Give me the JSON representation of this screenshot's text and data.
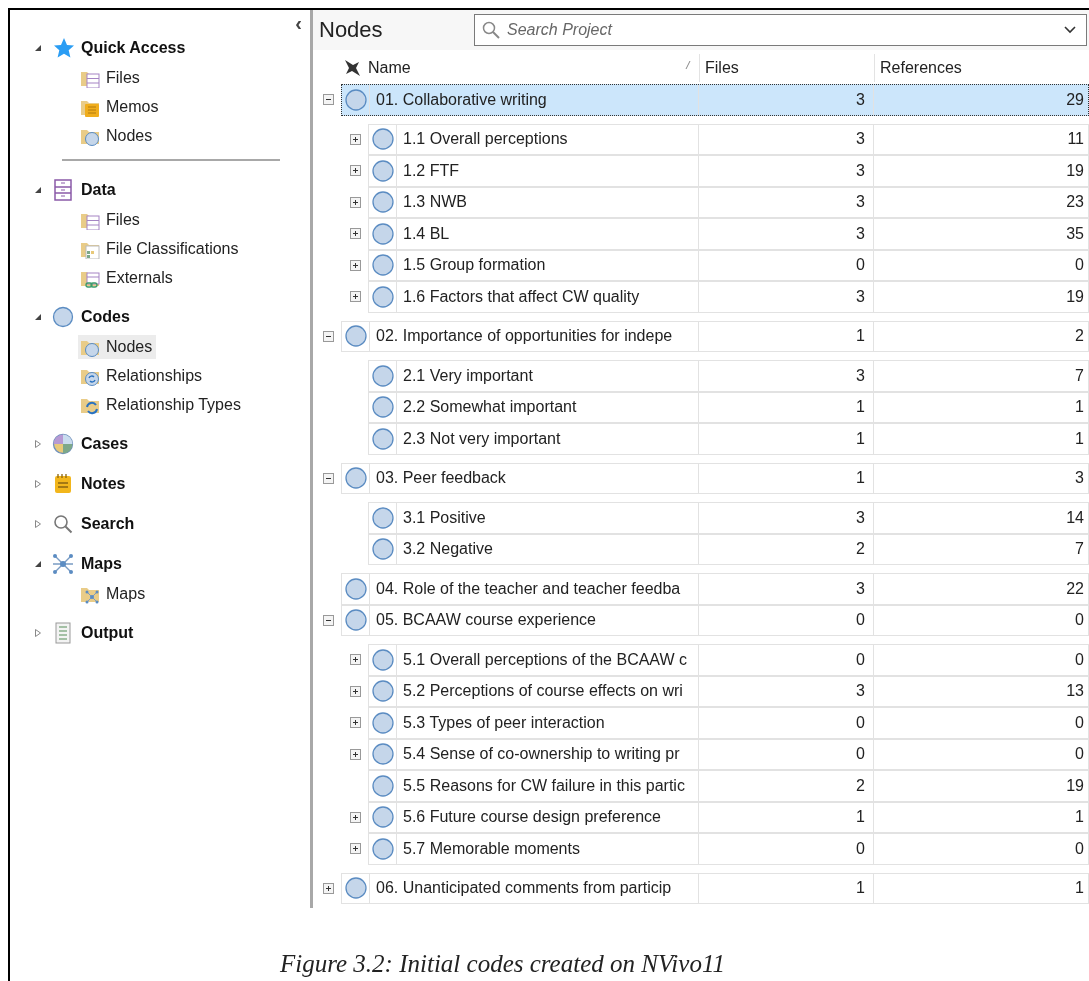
{
  "sidebar": {
    "collapse_glyph": "‹",
    "sections": [
      {
        "label": "Quick Access",
        "kind": "star",
        "expanded": true,
        "divider": true,
        "items": [
          {
            "label": "Files",
            "kind": "files",
            "selected": false
          },
          {
            "label": "Memos",
            "kind": "memos",
            "selected": false
          },
          {
            "label": "Nodes",
            "kind": "nodes",
            "selected": false
          }
        ]
      },
      {
        "label": "Data",
        "kind": "cabinet",
        "expanded": true,
        "divider": false,
        "items": [
          {
            "label": "Files",
            "kind": "files",
            "selected": false
          },
          {
            "label": "File Classifications",
            "kind": "classifications",
            "selected": false
          },
          {
            "label": "Externals",
            "kind": "externals",
            "selected": false
          }
        ]
      },
      {
        "label": "Codes",
        "kind": "node",
        "expanded": true,
        "divider": false,
        "items": [
          {
            "label": "Nodes",
            "kind": "nodes",
            "selected": true
          },
          {
            "label": "Relationships",
            "kind": "relationships",
            "selected": false
          },
          {
            "label": "Relationship Types",
            "kind": "relationship-types",
            "selected": false
          }
        ]
      },
      {
        "label": "Cases",
        "kind": "cases",
        "expanded": false,
        "divider": false
      },
      {
        "label": "Notes",
        "kind": "notes",
        "expanded": false,
        "divider": false
      },
      {
        "label": "Search",
        "kind": "search",
        "expanded": false,
        "divider": false
      },
      {
        "label": "Maps",
        "kind": "network",
        "expanded": true,
        "divider": false,
        "items": [
          {
            "label": "Maps",
            "kind": "maps",
            "selected": false
          }
        ]
      },
      {
        "label": "Output",
        "kind": "output",
        "expanded": false,
        "divider": false
      }
    ]
  },
  "main": {
    "title": "Nodes",
    "search": {
      "placeholder": "Search Project"
    }
  },
  "table": {
    "columns": [
      "Name",
      "Files",
      "References"
    ]
  },
  "nodes": [
    {
      "name": "01. Collaborative writing",
      "files": "3",
      "references": "29",
      "selected": true,
      "kind": "branch",
      "expanded": true,
      "children": [
        {
          "name": "1.1 Overall perceptions",
          "files": "3",
          "references": "11",
          "selected": false,
          "kind": "branch",
          "expanded": false
        },
        {
          "name": "1.2 FTF",
          "files": "3",
          "references": "19",
          "selected": false,
          "kind": "branch",
          "expanded": false
        },
        {
          "name": "1.3 NWB",
          "files": "3",
          "references": "23",
          "selected": false,
          "kind": "branch",
          "expanded": false
        },
        {
          "name": "1.4 BL",
          "files": "3",
          "references": "35",
          "selected": false,
          "kind": "branch",
          "expanded": false
        },
        {
          "name": "1.5 Group formation",
          "files": "0",
          "references": "0",
          "selected": false,
          "kind": "branch",
          "expanded": false
        },
        {
          "name": "1.6 Factors that affect CW quality",
          "files": "3",
          "references": "19",
          "selected": false,
          "kind": "branch",
          "expanded": false
        }
      ]
    },
    {
      "name": "02. Importance of opportunities for indepe",
      "files": "1",
      "references": "2",
      "selected": false,
      "kind": "branch",
      "expanded": true,
      "children": [
        {
          "name": "2.1 Very important",
          "files": "3",
          "references": "7",
          "selected": false,
          "kind": "leaf"
        },
        {
          "name": "2.2 Somewhat important",
          "files": "1",
          "references": "1",
          "selected": false,
          "kind": "leaf"
        },
        {
          "name": "2.3 Not very important",
          "files": "1",
          "references": "1",
          "selected": false,
          "kind": "leaf"
        }
      ]
    },
    {
      "name": "03. Peer feedback",
      "files": "1",
      "references": "3",
      "selected": false,
      "kind": "branch",
      "expanded": true,
      "children": [
        {
          "name": "3.1 Positive",
          "files": "3",
          "references": "14",
          "selected": false,
          "kind": "leaf"
        },
        {
          "name": "3.2 Negative",
          "files": "2",
          "references": "7",
          "selected": false,
          "kind": "leaf"
        }
      ]
    },
    {
      "name": "04. Role of the teacher and teacher feedba",
      "files": "3",
      "references": "22",
      "selected": false,
      "kind": "leaf"
    },
    {
      "name": "05. BCAAW course experience",
      "files": "0",
      "references": "0",
      "selected": false,
      "kind": "branch",
      "expanded": true,
      "children": [
        {
          "name": "5.1 Overall perceptions of the BCAAW c",
          "files": "0",
          "references": "0",
          "selected": false,
          "kind": "branch",
          "expanded": false
        },
        {
          "name": "5.2 Perceptions of course effects on wri",
          "files": "3",
          "references": "13",
          "selected": false,
          "kind": "branch",
          "expanded": false
        },
        {
          "name": "5.3 Types of peer interaction",
          "files": "0",
          "references": "0",
          "selected": false,
          "kind": "branch",
          "expanded": false
        },
        {
          "name": "5.4 Sense of co-ownership to writing pr",
          "files": "0",
          "references": "0",
          "selected": false,
          "kind": "branch",
          "expanded": false
        },
        {
          "name": "5.5 Reasons for CW failure in this partic",
          "files": "2",
          "references": "19",
          "selected": false,
          "kind": "leaf"
        },
        {
          "name": "5.6 Future course design preference",
          "files": "1",
          "references": "1",
          "selected": false,
          "kind": "branch",
          "expanded": false
        },
        {
          "name": "5.7 Memorable moments",
          "files": "0",
          "references": "0",
          "selected": false,
          "kind": "branch",
          "expanded": false
        }
      ]
    },
    {
      "name": "06. Unanticipated comments from particip",
      "files": "1",
      "references": "1",
      "selected": false,
      "kind": "branch",
      "expanded": false
    }
  ],
  "caption": "Figure 3.2: Initial codes created on NVivo11"
}
